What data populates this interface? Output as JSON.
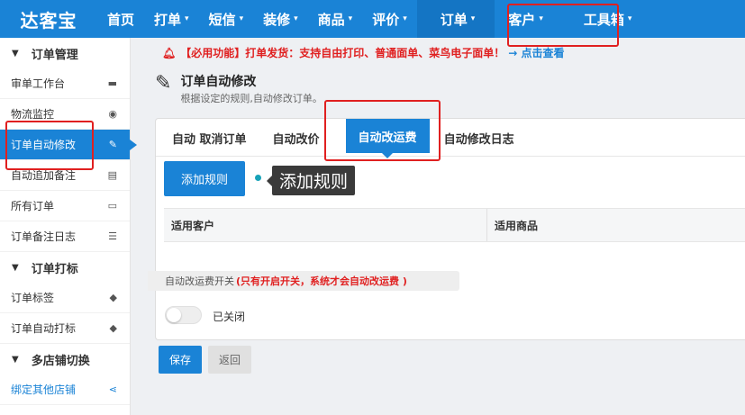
{
  "header": {
    "logo_text": "达客宝",
    "nav": [
      {
        "label": "首页",
        "has_caret": false
      },
      {
        "label": "打单",
        "has_caret": true
      },
      {
        "label": "短信",
        "has_caret": true
      },
      {
        "label": "装修",
        "has_caret": true
      },
      {
        "label": "商品",
        "has_caret": true
      },
      {
        "label": "评价",
        "has_caret": true
      },
      {
        "label": "订单",
        "has_caret": true
      },
      {
        "label": "客户",
        "has_caret": true
      },
      {
        "label": "工具箱",
        "has_caret": true
      }
    ],
    "caret": "▾"
  },
  "sidebar": {
    "groups": [
      {
        "title": "订单管理",
        "items": [
          {
            "label": "审单工作台",
            "icon": "truck-icon"
          },
          {
            "label": "物流监控",
            "icon": "eye-icon"
          },
          {
            "label": "订单自动修改",
            "icon": "edit-icon"
          },
          {
            "label": "自动追加备注",
            "icon": "list-icon"
          },
          {
            "label": "所有订单",
            "icon": "card-icon"
          },
          {
            "label": "订单备注日志",
            "icon": "list-icon"
          }
        ]
      },
      {
        "title": "订单打标",
        "items": [
          {
            "label": "订单标签",
            "icon": "tag-icon"
          },
          {
            "label": "订单自动打标",
            "icon": "tag-icon"
          }
        ]
      },
      {
        "title": "多店铺切换",
        "items": [
          {
            "label": "绑定其他店铺",
            "icon": "share-icon"
          }
        ]
      }
    ]
  },
  "notice": {
    "text": "【必用功能】打单发货：支持自由打印、普通面单、菜鸟电子面单！",
    "link": "→ 点击查看"
  },
  "page": {
    "title": "订单自动修改",
    "subtitle": "根据设定的规则,自动修改订单。"
  },
  "tabs": [
    "自动 取消订单",
    "自动改价",
    "自动改运费",
    "自动修改日志"
  ],
  "rules": {
    "add_button": "添加规则",
    "tooltip": "添加规则",
    "columns": [
      "适用客户",
      "适用商品"
    ]
  },
  "switch": {
    "label": "自动改运费开关",
    "warning": "(只有开启开关，系统才会自动改运费 )",
    "state": "已关闭",
    "on": false
  },
  "actions": {
    "save": "保存",
    "back": "返回"
  },
  "colors": {
    "primary": "#1a83d6",
    "warning": "#e02020",
    "highlight_box": "#e02020"
  }
}
